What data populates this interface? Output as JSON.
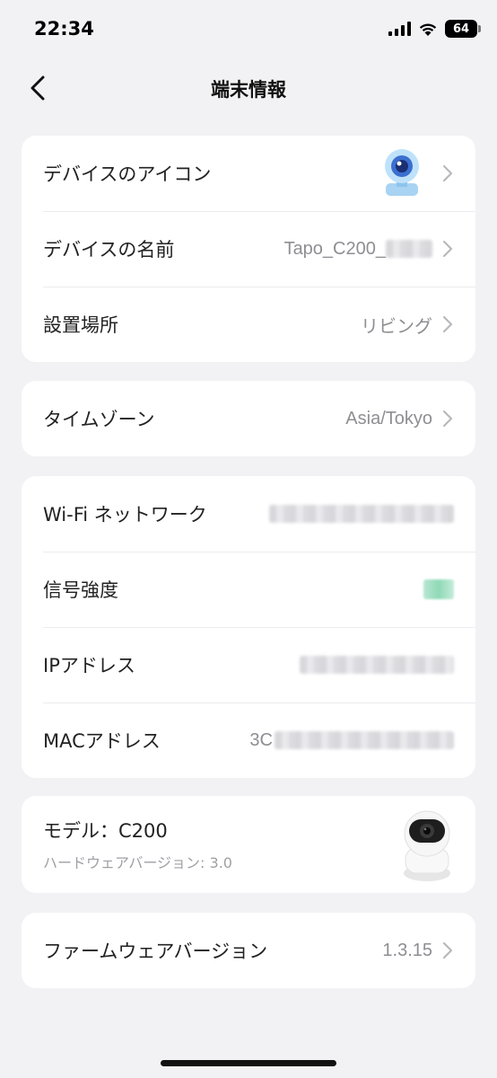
{
  "status_bar": {
    "time": "22:34",
    "battery": "64"
  },
  "nav": {
    "title": "端末情報"
  },
  "card1": {
    "rows": [
      {
        "label": "デバイスのアイコン",
        "value": ""
      },
      {
        "label": "デバイスの名前",
        "value": "Tapo_C200_"
      },
      {
        "label": "設置場所",
        "value": "リビング"
      }
    ]
  },
  "card2": {
    "rows": [
      {
        "label": "タイムゾーン",
        "value": "Asia/Tokyo"
      }
    ]
  },
  "card3": {
    "rows": [
      {
        "label": "Wi-Fi ネットワーク"
      },
      {
        "label": "信号強度"
      },
      {
        "label": "IPアドレス"
      },
      {
        "label": "MACアドレス",
        "value_prefix": "3C"
      }
    ]
  },
  "card4": {
    "model": "モデル：C200",
    "hardware_version": "ハードウェアバージョン: 3.0"
  },
  "card5": {
    "label": "ファームウェアバージョン",
    "value": "1.3.15"
  },
  "colors": {
    "background": "#f2f2f4",
    "card": "#ffffff",
    "secondary_text": "#8e8e93",
    "signal": "#8fd9b6"
  }
}
